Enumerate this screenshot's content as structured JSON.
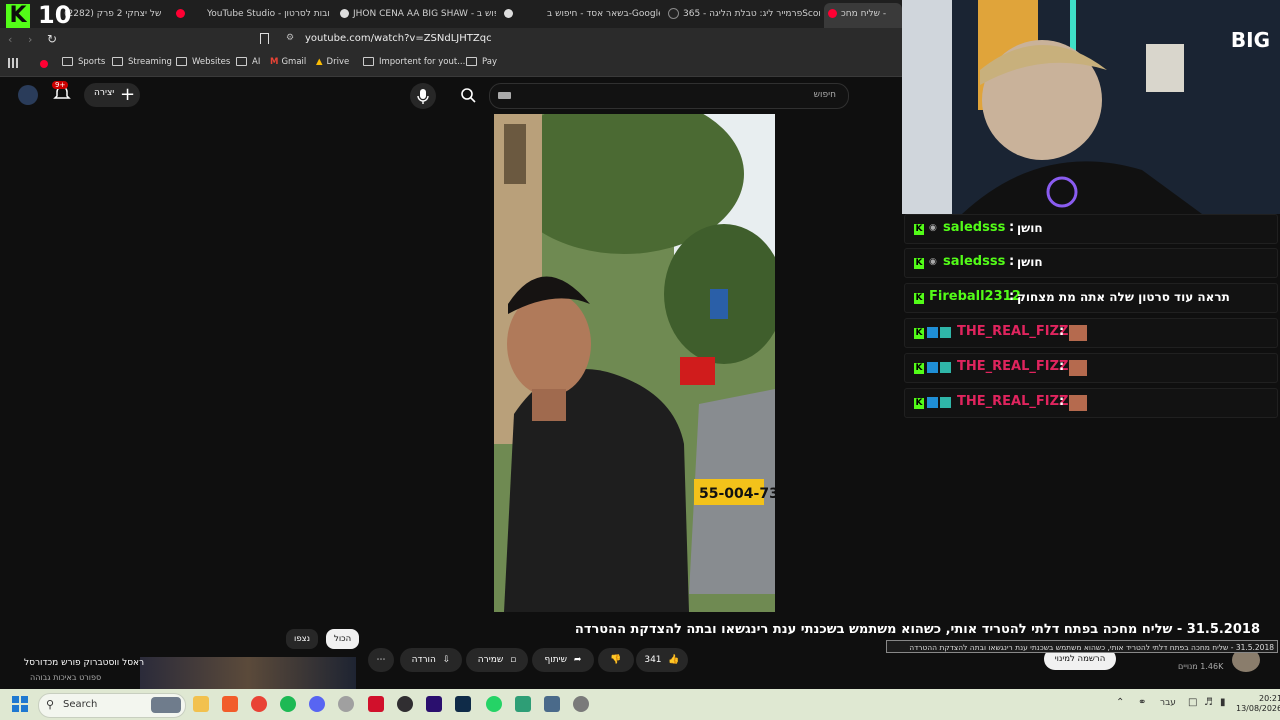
{
  "overlay": {
    "logo_letter": "K",
    "number": "10",
    "cam_logo": "BIG"
  },
  "tabs": [
    {
      "label": "(2282) בגג של יצחקי 2 פרק",
      "icon": "youtube-icon"
    },
    {
      "label": "YouTube Studio - תגובות לסרטון",
      "icon": "youtube-studio-icon"
    },
    {
      "label": "JHON CENA AA BIG SHAW - חיפוש ב",
      "icon": "google-icon"
    },
    {
      "label": "בשאר אסד - חיפוש ב-Google",
      "icon": "google-icon"
    },
    {
      "label": "פרמייר ליג: טבלת הליגה - 365Scores",
      "icon": "365scores-icon"
    },
    {
      "label": "שליח מחכ -",
      "icon": "youtube-icon"
    }
  ],
  "address": {
    "url": "youtube.com/watch?v=ZSNdLJHTZqc"
  },
  "bookmarks": [
    "Sports",
    "Streaming",
    "Websites",
    "AI",
    "Gmail",
    "Drive",
    "Importent for yout...",
    "Pay"
  ],
  "header": {
    "search_placeholder": "חיפוש",
    "create_label": "יצירה",
    "notif_count": "9+"
  },
  "video": {
    "plate_text": "55-004-73",
    "title": "31.5.2018 - שליח מחכה בפתח דלתי להטריד אותי, כשהוא משתמש בשכנתי ענת רינגשאו ובתה להצדקת ההטרדה",
    "tooltip": "31.5.2018 - שליח מחכה בפתח דלתי להטריד אותי, כשהוא משתמש בשכנתי ענת רינגשאו ובתה להצדקת ההטרדה",
    "likes": "341",
    "share_label": "שיתוף",
    "save_label": "שמירה",
    "download_label": "הורדה",
    "subscribe_label": "הרשמה למינוי",
    "subscribers": "1.46K מנויים"
  },
  "filters": {
    "all": "הכול",
    "watched": "נצפו"
  },
  "recommended": {
    "title": "ראסל ווסטברוק פורש מכדורסל",
    "channel": "ספורט באיכות גבוהה"
  },
  "chat": [
    {
      "user": "saledsss",
      "message": "חושן",
      "user_color": "#53fc18"
    },
    {
      "user": "saledsss",
      "message": "חושן",
      "user_color": "#53fc18"
    },
    {
      "user": "Fireball2312",
      "message": "תראה עוד סרטון שלה אתה מת מצחוק",
      "user_color": "#53fc18"
    },
    {
      "user": "THE_REAL_FIZZ",
      "message": "",
      "user_color": "#e0245e"
    },
    {
      "user": "THE_REAL_FIZZ",
      "message": "",
      "user_color": "#e0245e"
    },
    {
      "user": "THE_REAL_FIZZ",
      "message": "",
      "user_color": "#e0245e"
    }
  ],
  "taskbar": {
    "search_label": "Search",
    "lang": "עבר",
    "time": "20:21",
    "date": "13/08/2026"
  }
}
